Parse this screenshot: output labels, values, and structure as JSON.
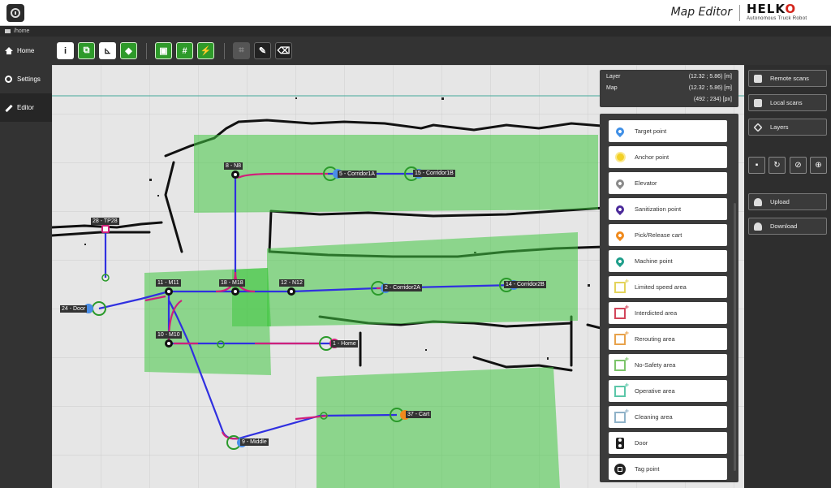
{
  "header": {
    "title": "Map Editor",
    "brand_name_1": "HELK",
    "brand_name_2": "O",
    "brand_tagline": "Autonomous Truck Robot"
  },
  "breadcrumb": {
    "path": "/home"
  },
  "nav": [
    {
      "label": "Home",
      "icon": "home-icon"
    },
    {
      "label": "Settings",
      "icon": "gear-icon"
    },
    {
      "label": "Editor",
      "icon": "pencil-icon",
      "active": true
    }
  ],
  "toolbar": {
    "icons": [
      "info-icon",
      "copy-icon",
      "ruler-icon",
      "tag-icon",
      "lock-icon",
      "grid-icon",
      "snap-icon",
      "crop-icon",
      "pencil-icon",
      "eraser-icon"
    ]
  },
  "info": {
    "layer_label": "Layer",
    "layer_value": "(12.32 ; 5.86) [m]",
    "map_label": "Map",
    "map_value": "(12.32 ; 5.86) [m]",
    "px_value": "(492 ; 234) [px]"
  },
  "elements_panel": [
    {
      "label": "Target point",
      "icon": "target-point-icon",
      "color": "#3f8fe6"
    },
    {
      "label": "Anchor point",
      "icon": "anchor-point-icon",
      "color": "#f2d027"
    },
    {
      "label": "Elevator",
      "icon": "elevator-icon",
      "color": "#8a8a8a"
    },
    {
      "label": "Sanitization point",
      "icon": "sanitization-point-icon",
      "color": "#4b2a9a"
    },
    {
      "label": "Pick/Release cart",
      "icon": "pick-release-cart-icon",
      "color": "#f08a1c"
    },
    {
      "label": "Machine point",
      "icon": "machine-point-icon",
      "color": "#1e9e8a"
    },
    {
      "label": "Limited speed area",
      "icon": "limited-speed-area-icon",
      "color": "#e3d35a"
    },
    {
      "label": "Interdicted area",
      "icon": "interdicted-area-icon",
      "color": "#d2455a"
    },
    {
      "label": "Rerouting area",
      "icon": "rerouting-area-icon",
      "color": "#e8a24b"
    },
    {
      "label": "No-Safety area",
      "icon": "no-safety-area-icon",
      "color": "#7cc46a"
    },
    {
      "label": "Operative area",
      "icon": "operative-area-icon",
      "color": "#5bc6a8"
    },
    {
      "label": "Cleaning area",
      "icon": "cleaning-area-icon",
      "color": "#8fb2c8"
    },
    {
      "label": "Door",
      "icon": "door-icon",
      "color": "#222222"
    },
    {
      "label": "Tag point",
      "icon": "tag-point-icon",
      "color": "#222222"
    }
  ],
  "right_buttons": {
    "remote_scans": "Remote scans",
    "local_scans": "Local scans",
    "layers": "Layers",
    "upload": "Upload",
    "download": "Download"
  },
  "map_nodes": [
    {
      "label": "8 - N8"
    },
    {
      "label": "5 - Corridor1A"
    },
    {
      "label": "15 - Corridor1B"
    },
    {
      "label": "28 - TP28"
    },
    {
      "label": "11 - M11"
    },
    {
      "label": "18 - M18"
    },
    {
      "label": "12 - N12"
    },
    {
      "label": "2 - Corridor2A"
    },
    {
      "label": "14 - Corridor2B"
    },
    {
      "label": "24 - Door"
    },
    {
      "label": "10 - M10"
    },
    {
      "label": "1 - Home"
    },
    {
      "label": "37 - Cart"
    },
    {
      "label": "9 - Middle"
    }
  ]
}
